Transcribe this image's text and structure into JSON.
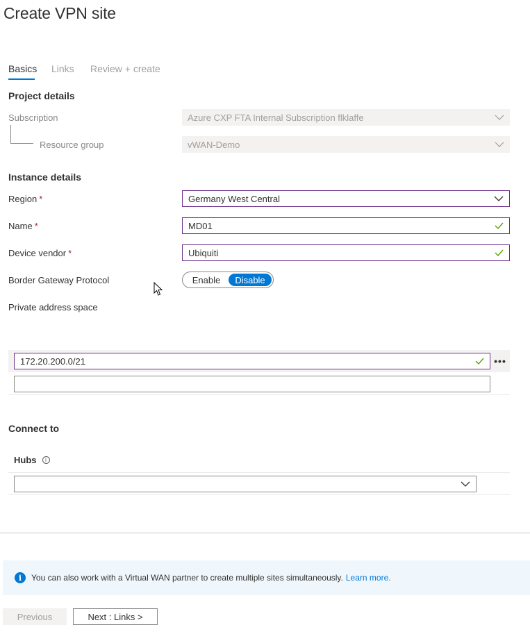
{
  "page": {
    "title": "Create VPN site"
  },
  "tabs": [
    {
      "label": "Basics",
      "active": true
    },
    {
      "label": "Links",
      "active": false
    },
    {
      "label": "Review + create",
      "active": false
    }
  ],
  "project_details": {
    "heading": "Project details",
    "subscription": {
      "label": "Subscription",
      "value": "Azure CXP FTA Internal Subscription flklaffe"
    },
    "resource_group": {
      "label": "Resource group",
      "value": "vWAN-Demo"
    }
  },
  "instance_details": {
    "heading": "Instance details",
    "region": {
      "label": "Region",
      "required": "*",
      "value": "Germany West Central"
    },
    "name": {
      "label": "Name",
      "required": "*",
      "value": "MD01"
    },
    "device_vendor": {
      "label": "Device vendor",
      "required": "*",
      "value": "Ubiquiti"
    },
    "bgp": {
      "label": "Border Gateway Protocol",
      "enable_label": "Enable",
      "disable_label": "Disable",
      "selected": "Disable"
    },
    "private_address_space": {
      "label": "Private address space",
      "entries": [
        "172.20.200.0/21",
        ""
      ]
    }
  },
  "connect_to": {
    "heading": "Connect to",
    "hubs": {
      "label": "Hubs",
      "value": ""
    }
  },
  "info_bar": {
    "text": "You can also work with a Virtual WAN partner to create multiple sites simultaneously.",
    "link": "Learn more."
  },
  "footer": {
    "previous_label": "Previous",
    "next_label": "Next : Links >"
  },
  "colors": {
    "accent": "#0078d4",
    "valid": "#57a300",
    "highlight_border": "#6b2d8a"
  }
}
